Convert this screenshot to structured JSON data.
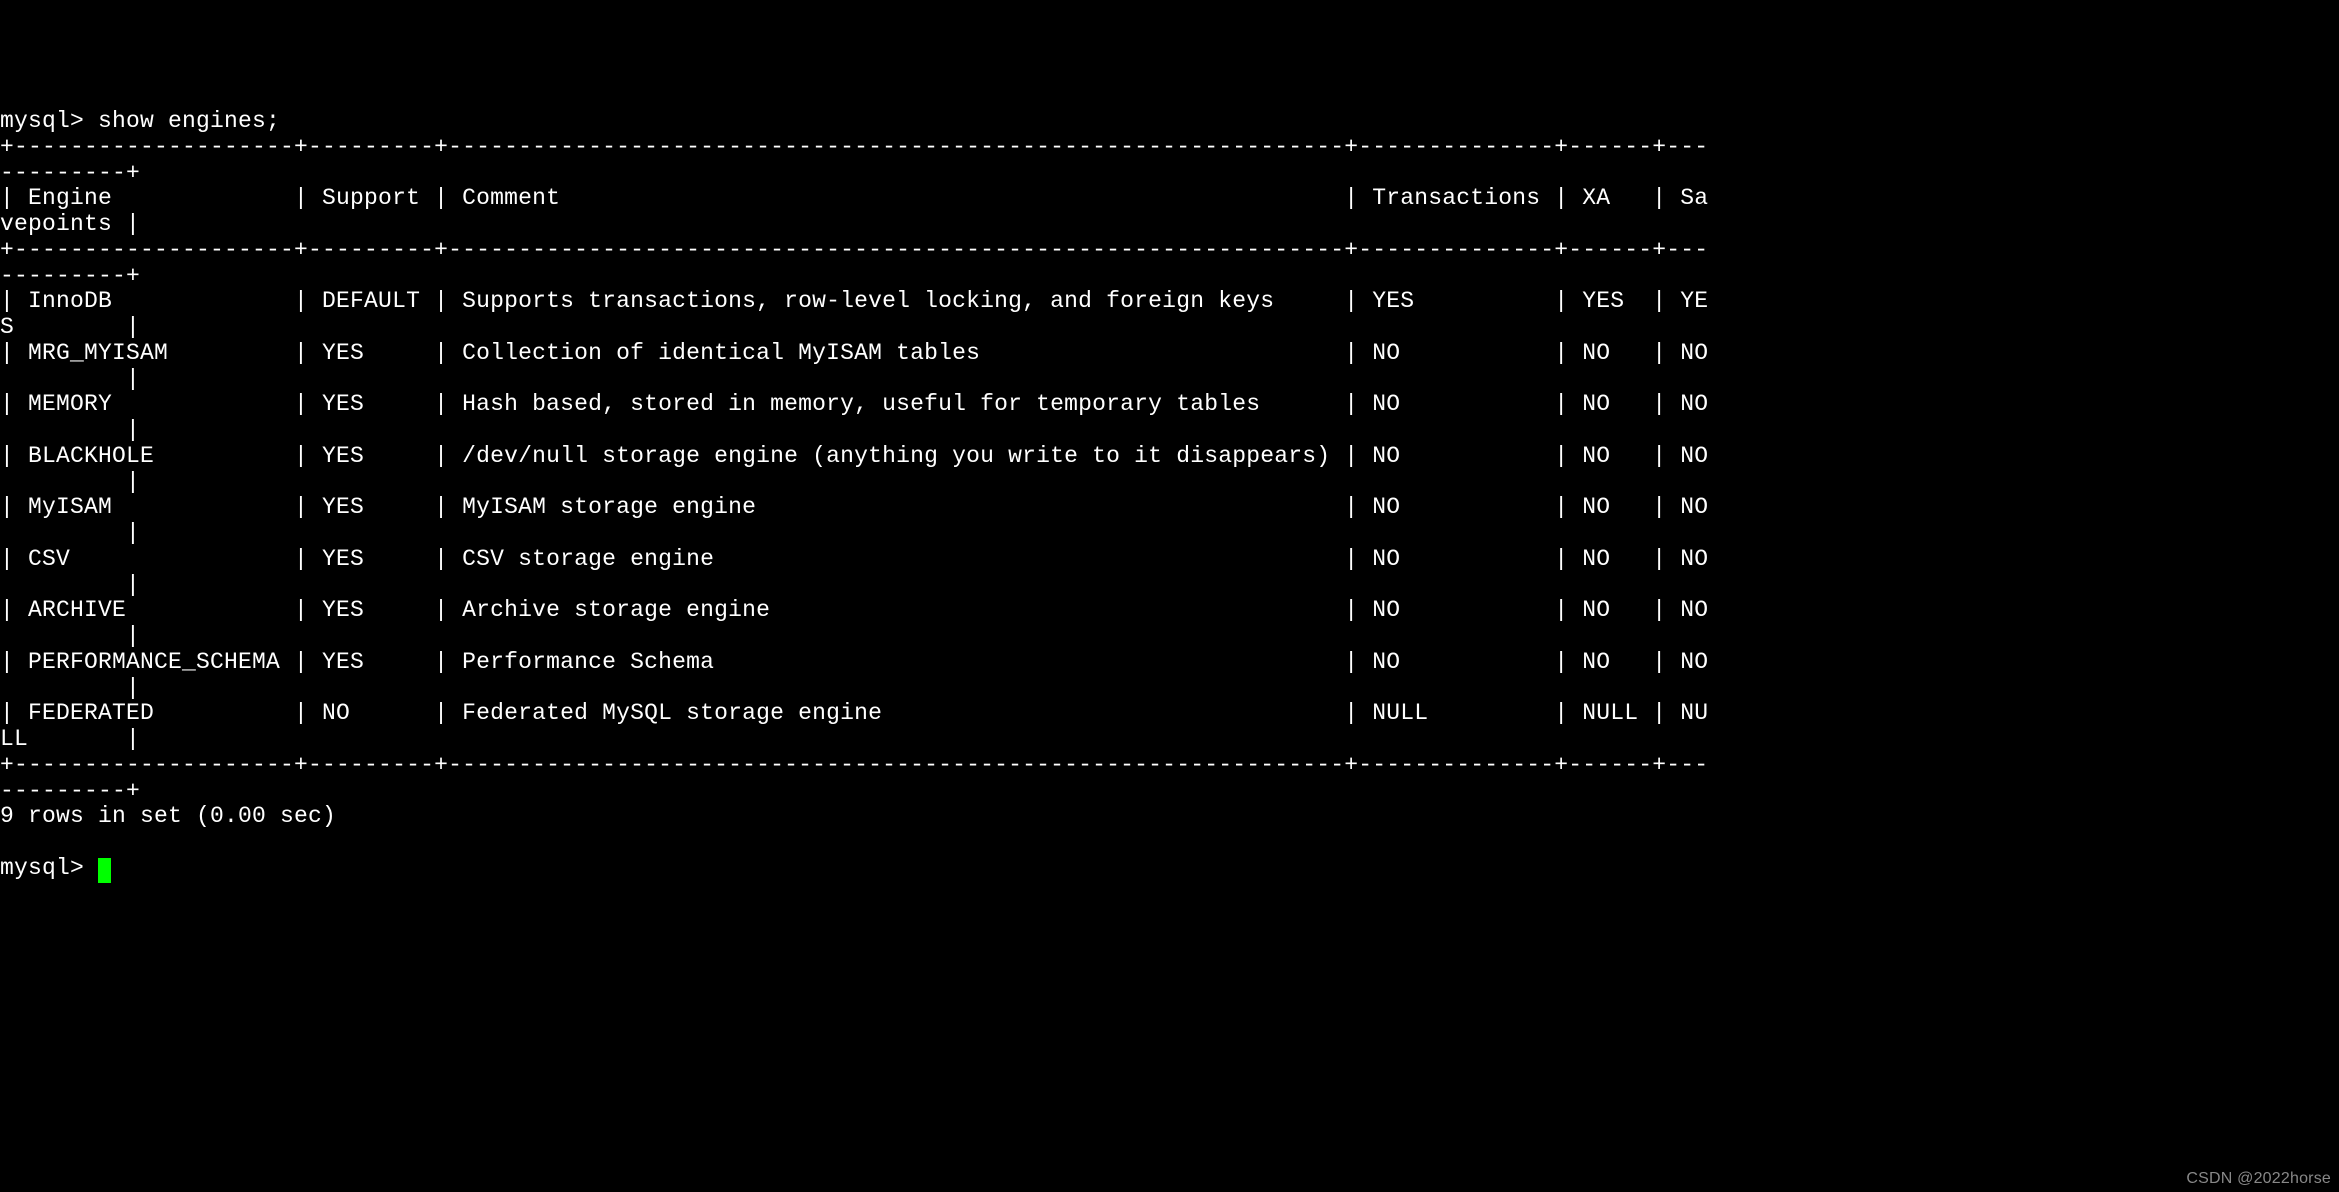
{
  "prompt1": "mysql> ",
  "command": "show engines;",
  "columns": {
    "engine": "Engine",
    "support": "Support",
    "comment": "Comment",
    "transactions": "Transactions",
    "xa": "XA",
    "savepoints": "Savepoints",
    "savepoints_wrap1": "Sa",
    "savepoints_wrap2": "vepoints"
  },
  "divider_full": "+--------------------+---------+----------------------------------------------------------------+--------------+------+------------+",
  "rows": [
    {
      "engine": "InnoDB",
      "support": "DEFAULT",
      "comment": "Supports transactions, row-level locking, and foreign keys",
      "transactions": "YES",
      "xa": "YES",
      "sv1": "YE",
      "sv2": "S"
    },
    {
      "engine": "MRG_MYISAM",
      "support": "YES",
      "comment": "Collection of identical MyISAM tables",
      "transactions": "NO",
      "xa": "NO",
      "sv1": "NO",
      "sv2": ""
    },
    {
      "engine": "MEMORY",
      "support": "YES",
      "comment": "Hash based, stored in memory, useful for temporary tables",
      "transactions": "NO",
      "xa": "NO",
      "sv1": "NO",
      "sv2": ""
    },
    {
      "engine": "BLACKHOLE",
      "support": "YES",
      "comment": "/dev/null storage engine (anything you write to it disappears)",
      "transactions": "NO",
      "xa": "NO",
      "sv1": "NO",
      "sv2": ""
    },
    {
      "engine": "MyISAM",
      "support": "YES",
      "comment": "MyISAM storage engine",
      "transactions": "NO",
      "xa": "NO",
      "sv1": "NO",
      "sv2": ""
    },
    {
      "engine": "CSV",
      "support": "YES",
      "comment": "CSV storage engine",
      "transactions": "NO",
      "xa": "NO",
      "sv1": "NO",
      "sv2": ""
    },
    {
      "engine": "ARCHIVE",
      "support": "YES",
      "comment": "Archive storage engine",
      "transactions": "NO",
      "xa": "NO",
      "sv1": "NO",
      "sv2": ""
    },
    {
      "engine": "PERFORMANCE_SCHEMA",
      "support": "YES",
      "comment": "Performance Schema",
      "transactions": "NO",
      "xa": "NO",
      "sv1": "NO",
      "sv2": ""
    },
    {
      "engine": "FEDERATED",
      "support": "NO",
      "comment": "Federated MySQL storage engine",
      "transactions": "NULL",
      "xa": "NULL",
      "sv1": "NU",
      "sv2": "LL"
    }
  ],
  "result_text": "9 rows in set (0.00 sec)",
  "prompt2": "mysql> ",
  "watermark": "CSDN @2022horse",
  "col_widths": {
    "engine": 18,
    "support": 7,
    "comment": 62,
    "transactions": 12,
    "xa": 4,
    "sv": 2
  }
}
